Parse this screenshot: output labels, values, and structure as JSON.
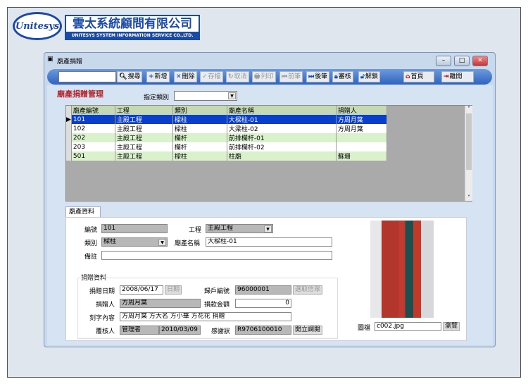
{
  "logo": {
    "cn": "雲太系統顧問有限公司",
    "en": "UNITESYS SYSTEM INFORMATION SERVICE CO.,LTD.",
    "mark": "Unitesys"
  },
  "window": {
    "title": "廟產捐贈"
  },
  "toolbar": {
    "search_value": "",
    "search": "搜尋",
    "add": "新增",
    "delete": "刪除",
    "save": "存檔",
    "cancel": "取消",
    "print": "列印",
    "prev": "前筆",
    "next": "後筆",
    "audit": "審核",
    "unlock": "解鎖",
    "home": "首頁",
    "exit": "離開"
  },
  "main": {
    "title": "廟產捐贈管理",
    "category_label": "指定類別",
    "category_value": ""
  },
  "grid": {
    "headers": [
      "廟產編號",
      "工程",
      "類別",
      "廟產名稱",
      "捐贈人"
    ],
    "rows": [
      [
        "101",
        "主殿工程",
        "樑柱",
        "大樑柱-01",
        "方周月葉"
      ],
      [
        "102",
        "主殿工程",
        "樑柱",
        "大梁柱-02",
        "方周月葉"
      ],
      [
        "202",
        "主殿工程",
        "欄杆",
        "前排欄杆-01",
        ""
      ],
      [
        "203",
        "主殿工程",
        "欄杆",
        "前排欄杆-02",
        ""
      ],
      [
        "501",
        "主殿工程",
        "樑柱",
        "柱廟",
        "蘇珊"
      ]
    ],
    "selected": 0
  },
  "tab": {
    "label": "廟產資料"
  },
  "form": {
    "id_label": "編號",
    "id": "101",
    "project_label": "工程",
    "project": "主殿工程",
    "type_label": "類別",
    "type": "樑柱",
    "name_label": "廟產名稱",
    "name": "大樑柱-01",
    "note_label": "備註",
    "note": "",
    "group_label": "捐贈資料",
    "date_label": "捐贈日期",
    "date": "2008/06/17",
    "date_btn": "日期",
    "account_label": "歸戶編號",
    "account": "96000001",
    "pick_btn": "選取信眾",
    "donor_label": "捐贈人",
    "donor": "方周月葉",
    "amount_label": "捐款金額",
    "amount": "0",
    "engrave_label": "刻字內容",
    "engrave": "方周月葉 方大名 方小華 方花花 捐贈",
    "reviewer_label": "覆核人",
    "reviewer": "管理者",
    "review_date": "2010/03/09",
    "cert_label": "感謝狀",
    "cert": "R9706100010",
    "cert_btn": "開立調閱",
    "image_label": "圖檔",
    "image": "c002.jpg",
    "browse_btn": "瀏覽"
  }
}
